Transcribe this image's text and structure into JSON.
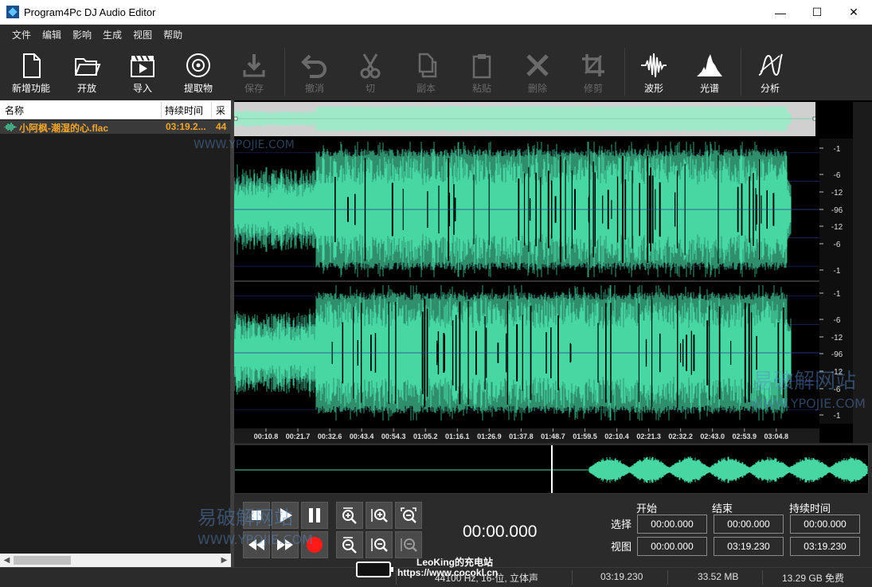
{
  "window": {
    "title": "Program4Pc DJ Audio Editor",
    "minimize": "—",
    "maximize": "☐",
    "close": "✕"
  },
  "menu": [
    "文件",
    "编辑",
    "影响",
    "生成",
    "视图",
    "帮助"
  ],
  "toolbar": {
    "new": "新增功能",
    "open": "开放",
    "import": "导入",
    "extract": "提取物",
    "save": "保存",
    "undo": "撤消",
    "cut": "切",
    "copy": "副本",
    "paste": "粘贴",
    "delete": "删除",
    "trim": "修剪",
    "waveform": "波形",
    "spectrum": "光谱",
    "analysis": "分析"
  },
  "file_list": {
    "headers": {
      "name": "名称",
      "duration": "持续时间",
      "sample": "采样"
    },
    "rows": [
      {
        "name": "小阿枫-潮湿的心.flac",
        "duration": "03:19.2...",
        "sample": "44"
      }
    ]
  },
  "db_scale": [
    "-1",
    "-6",
    "-12",
    "-96",
    "-12",
    "-6",
    "-1",
    "-1",
    "-6",
    "-12",
    "-96",
    "-12",
    "-6",
    "-1"
  ],
  "time_ticks": [
    "00:10.8",
    "00:21.7",
    "00:32.6",
    "00:43.4",
    "00:54.3",
    "01:05.2",
    "01:16.1",
    "01:26.9",
    "01:37.8",
    "01:48.7",
    "01:59.5",
    "02:10.4",
    "02:21.3",
    "02:32.2",
    "02:43.0",
    "02:53.9",
    "03:04.8"
  ],
  "playback": {
    "time": "00:00.000"
  },
  "selection": {
    "headers": {
      "start": "开始",
      "end": "结束",
      "duration": "持续时间"
    },
    "select_label": "选择",
    "view_label": "视图",
    "select": {
      "start": "00:00.000",
      "end": "00:00.000",
      "duration": "00:00.000"
    },
    "view": {
      "start": "00:00.000",
      "end": "03:19.230",
      "duration": "03:19.230"
    }
  },
  "status": {
    "format": "44100 Hz, 16-位, 立体声",
    "length": "03:19.230",
    "size": "33.52 MB",
    "free": "13.29 GB 免费"
  },
  "overlay": {
    "line1": "LeoKing的充电站",
    "line2": "https://www.cocokl.cn"
  },
  "watermarks": {
    "site_cn": "易破解网站",
    "site_en": "WWW.YPOJIE.COM"
  },
  "colors": {
    "waveform": "#46d7a2",
    "waveform_dark": "#2f8f6c",
    "background": "#2b2b2b",
    "file_highlight": "#f2a52a"
  }
}
